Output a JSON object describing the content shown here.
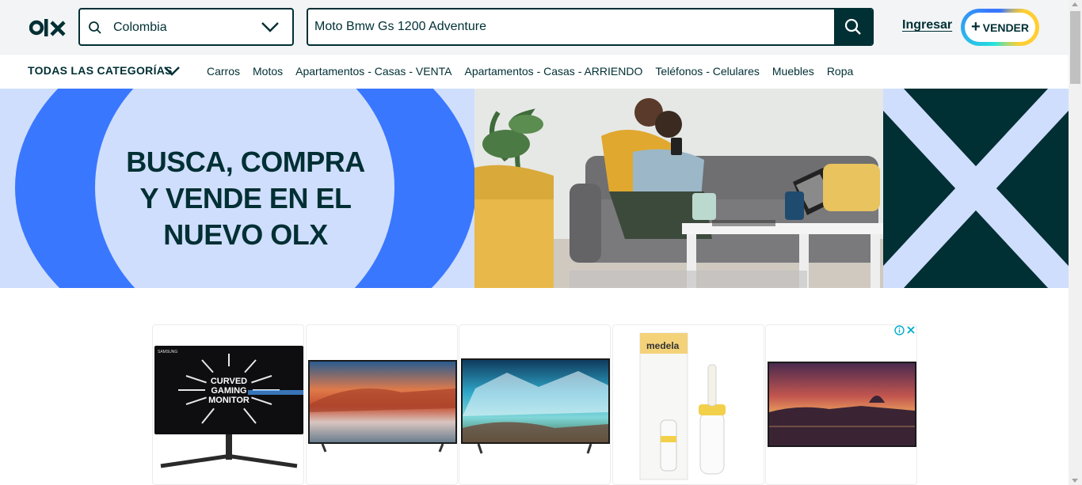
{
  "header": {
    "logo_text": "olx",
    "location": {
      "value": "Colombia"
    },
    "search": {
      "value": "Moto Bmw Gs 1200 Adventure"
    },
    "login_label": "Ingresar",
    "sell_label": "VENDER"
  },
  "categories": {
    "all_label": "TODAS LAS CATEGORÍAS",
    "items": [
      {
        "label": "Carros"
      },
      {
        "label": "Motos"
      },
      {
        "label": "Apartamentos - Casas - VENTA"
      },
      {
        "label": "Apartamentos - Casas - ARRIENDO"
      },
      {
        "label": "Teléfonos - Celulares"
      },
      {
        "label": "Muebles"
      },
      {
        "label": "Ropa"
      }
    ]
  },
  "banner": {
    "lines": [
      "BUSCA, COMPRA",
      "Y VENDE EN EL",
      "NUEVO OLX"
    ]
  },
  "ads": {
    "items": [
      {
        "name": "curved-gaming-monitor",
        "screen_text": "CURVED GAMING MONITOR",
        "brand_text": "SAMSUNG"
      },
      {
        "name": "tv-sunset-desert"
      },
      {
        "name": "tv-ice-landscape"
      },
      {
        "name": "medela-feeder",
        "brand_text": "medela"
      },
      {
        "name": "tv-rome-night"
      }
    ]
  },
  "colors": {
    "brand_dark": "#002f34",
    "banner_blue": "#3a77ff",
    "banner_light": "#cfdefc",
    "header_bg": "#f2f4f5"
  }
}
